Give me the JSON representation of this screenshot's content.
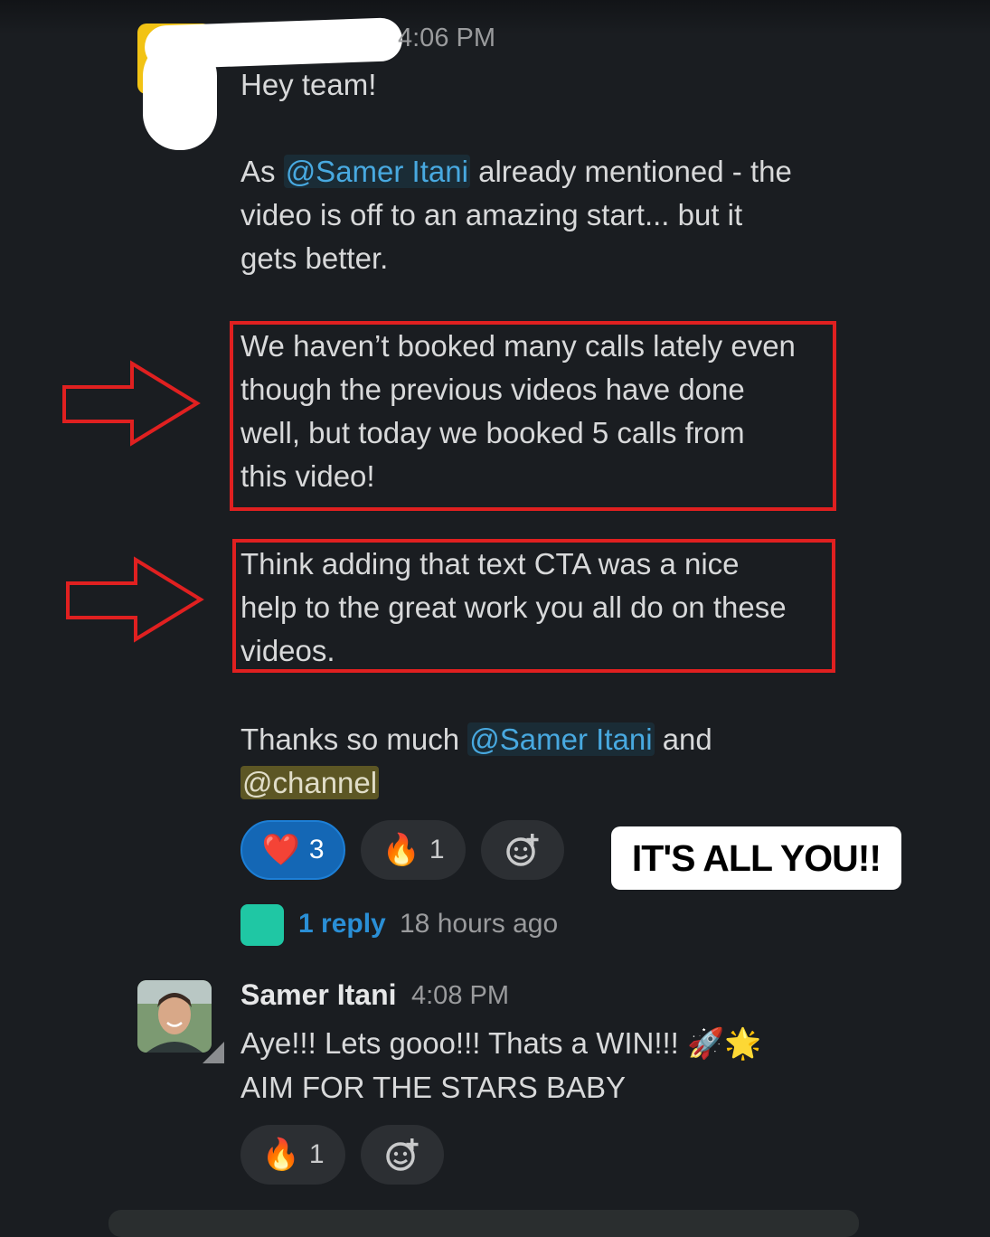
{
  "message1": {
    "time_fragment": "4:06 PM",
    "greeting": "Hey team!",
    "p1_line1_before": "As",
    "p1_mention": "@Samer Itani",
    "p1_line1_after": "already mentioned - the",
    "p1_line2": "video is off to an amazing start... but it",
    "p1_line3": "gets better.",
    "p2_line1": "We haven’t booked many calls lately even",
    "p2_line2": "though the previous videos have done",
    "p2_line3": "well, but today we booked 5 calls from",
    "p2_line4": "this video!",
    "p3_line1": "Think adding that text CTA was a nice",
    "p3_line2": "help to the great work you all do on these",
    "p3_line3": "videos.",
    "p4_before": "Thanks so much",
    "p4_mention": "@Samer Itani",
    "p4_after": "and",
    "p4_channel": "@channel",
    "reactions": [
      {
        "emoji": "❤️",
        "count": "3"
      },
      {
        "emoji": "🔥",
        "count": "1"
      }
    ],
    "replies": {
      "link": "1 reply",
      "time": "18 hours ago"
    }
  },
  "callout": "IT'S ALL YOU!!",
  "message2": {
    "sender": "Samer Itani",
    "time": "4:08 PM",
    "line1": "Aye!!! Lets gooo!!! Thats a WIN!!! 🚀🌟",
    "line2": "AIM FOR THE STARS BABY",
    "reactions": [
      {
        "emoji": "🔥",
        "count": "1"
      }
    ]
  },
  "icons": {
    "add_reaction": "add-reaction-icon",
    "arrow": "red-outline-arrow"
  },
  "colors": {
    "background": "#1a1d21",
    "mention": "#48a9e0",
    "highlight_border": "#e02020",
    "active_reaction": "#1467b5"
  }
}
